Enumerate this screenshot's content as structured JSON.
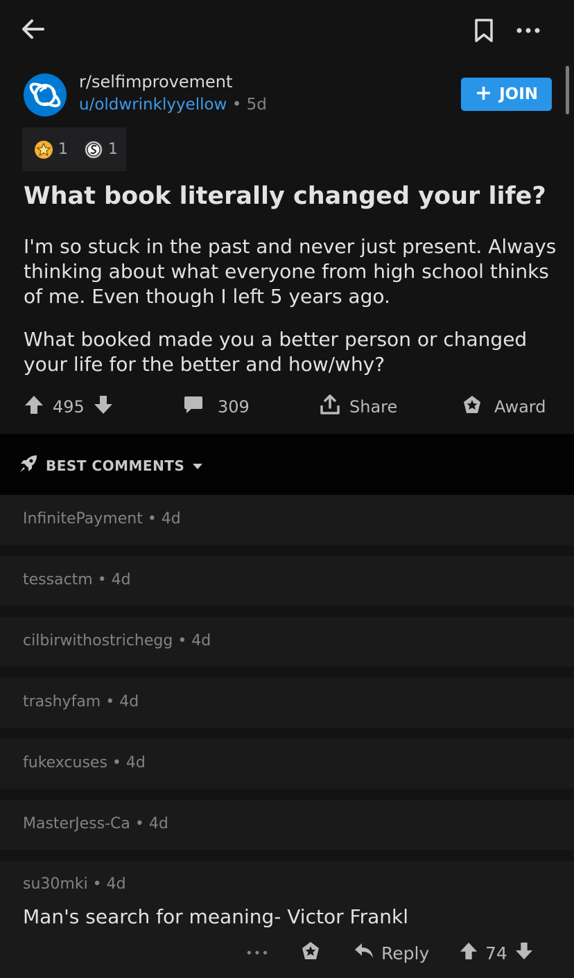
{
  "post": {
    "subreddit": "r/selfimprovement",
    "author": "u/oldwrinklyyellow",
    "separator": "•",
    "age": "5d",
    "join_label": "JOIN",
    "awards": [
      {
        "icon": "star-award-icon",
        "count": "1"
      },
      {
        "icon": "silver-award-icon",
        "count": "1"
      }
    ],
    "title": "What book literally changed your life?",
    "paragraphs": [
      "I'm so stuck in the past and never just present. Always thinking about what everyone from high school thinks of me. Even though I left 5 years ago.",
      "What booked made you a better person or changed your life for the better and how/why?"
    ],
    "score": "495",
    "comments_count": "309",
    "share_label": "Share",
    "award_label": "Award"
  },
  "sort": {
    "label": "BEST COMMENTS"
  },
  "comments": [
    {
      "author": "InfinitePayment",
      "age": "4d"
    },
    {
      "author": "tessactm",
      "age": "4d"
    },
    {
      "author": "cilbirwithostrichegg",
      "age": "4d"
    },
    {
      "author": "trashyfam",
      "age": "4d"
    },
    {
      "author": "fukexcuses",
      "age": "4d"
    },
    {
      "author": "MasterJess-Ca",
      "age": "4d"
    }
  ],
  "expanded_comment": {
    "author": "su30mki",
    "age": "4d",
    "text": "Man's search for meaning- Victor Frankl",
    "reply_label": "Reply",
    "score": "74",
    "more_label": "•••"
  },
  "colors": {
    "background": "#131314",
    "accent": "#2895e8",
    "link": "#3d9be9",
    "comment_bg": "#1a1a1b"
  }
}
